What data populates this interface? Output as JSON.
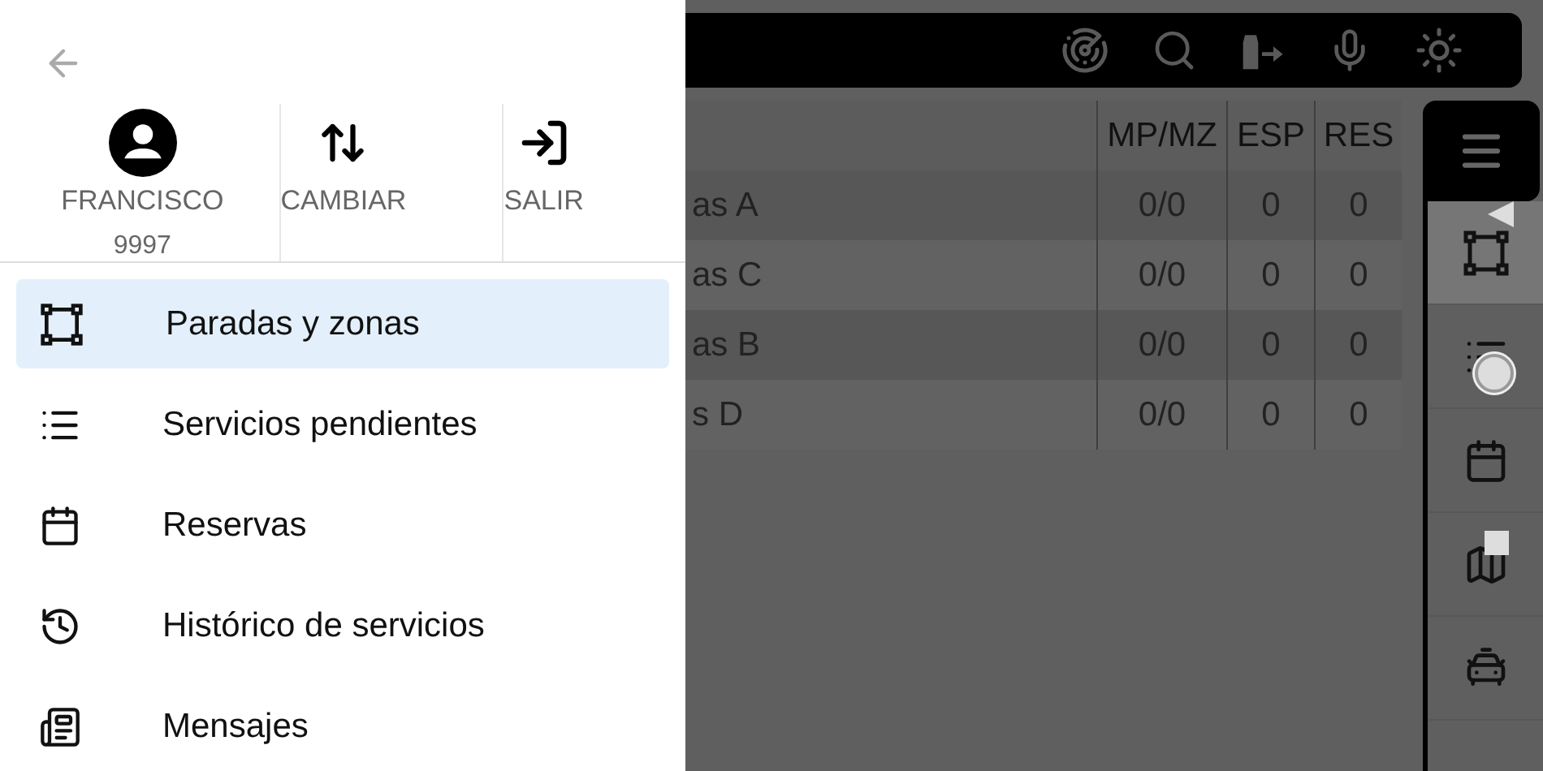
{
  "drawer": {
    "actions": [
      {
        "kind": "profile",
        "label": "FRANCISCO",
        "sublabel": "9997"
      },
      {
        "kind": "switch",
        "label": "CAMBIAR"
      },
      {
        "kind": "exit",
        "label": "SALIR"
      }
    ],
    "menu": [
      {
        "kind": "zones",
        "label": "Paradas y zonas",
        "selected": true
      },
      {
        "kind": "list",
        "label": "Servicios pendientes",
        "selected": false
      },
      {
        "kind": "calendar",
        "label": "Reservas",
        "selected": false
      },
      {
        "kind": "history",
        "label": "Histórico de servicios",
        "selected": false
      },
      {
        "kind": "messages",
        "label": "Mensajes",
        "selected": false
      }
    ]
  },
  "table": {
    "columns": [
      "MP/MZ",
      "ESP",
      "RES"
    ],
    "rows": [
      {
        "name": "as A",
        "cells": [
          "0/0",
          "0",
          "0"
        ]
      },
      {
        "name": "as C",
        "cells": [
          "0/0",
          "0",
          "0"
        ]
      },
      {
        "name": "as B",
        "cells": [
          "0/0",
          "0",
          "0"
        ]
      },
      {
        "name": "s D",
        "cells": [
          "0/0",
          "0",
          "0"
        ]
      }
    ]
  },
  "rail": [
    {
      "kind": "zones",
      "selected": true
    },
    {
      "kind": "list",
      "selected": false
    },
    {
      "kind": "calendar",
      "selected": false
    },
    {
      "kind": "map",
      "selected": false
    },
    {
      "kind": "taxi",
      "selected": false
    }
  ]
}
